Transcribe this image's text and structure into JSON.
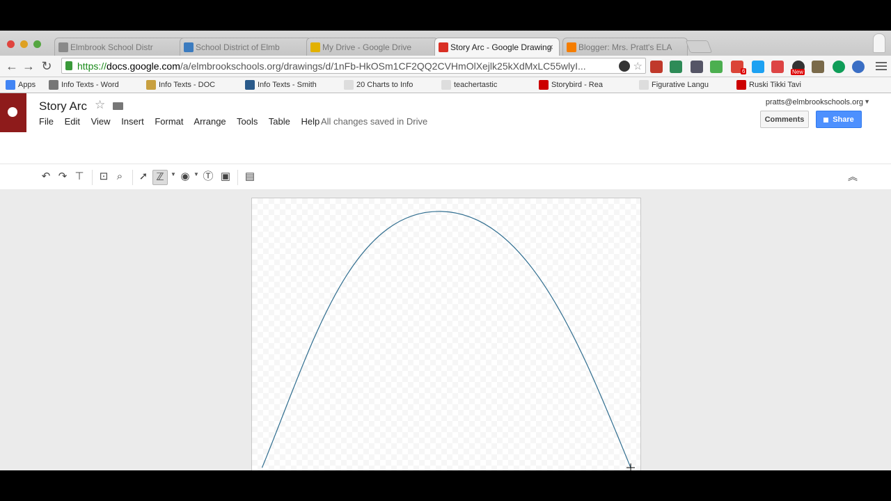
{
  "browser": {
    "tabs": [
      {
        "title": "Elmbrook School Distr",
        "active": false
      },
      {
        "title": "School District of Elmb",
        "active": false
      },
      {
        "title": "My Drive - Google Drive",
        "active": false
      },
      {
        "title": "Story Arc - Google Drawing",
        "active": true
      },
      {
        "title": "Blogger: Mrs. Pratt's ELA",
        "active": false
      }
    ],
    "close_glyph": "×",
    "url_scheme": "https://",
    "url_host": "docs.google.com",
    "url_path": "/a/elmbrookschools.org/drawings/d/1nFb-HkOSm1CF2QQ2CVHmOlXejlk25kXdMxLC55wlyI...",
    "bookmarks": [
      "Apps",
      "Info Texts - Word",
      "Info Texts - DOC",
      "Info Texts - Smith",
      "20 Charts to Info",
      "teachertastic",
      "Storybird - Rea",
      "Figurative Langu",
      "Ruski Tikki Tavi"
    ],
    "extension_badge_count": "6",
    "extension_badge_new": "New"
  },
  "docs": {
    "title": "Story Arc",
    "menus": [
      "File",
      "Edit",
      "View",
      "Insert",
      "Format",
      "Arrange",
      "Tools",
      "Table",
      "Help"
    ],
    "save_status": "All changes saved in Drive",
    "account": "pratts@elmbrookschools.org",
    "comments_label": "Comments",
    "share_label": "Share"
  },
  "icons": {
    "undo": "undo-icon",
    "redo": "redo-icon",
    "paint_format": "paint-format-icon",
    "zoom_fit": "zoom-fit-icon",
    "zoom": "zoom-icon",
    "select": "select-icon",
    "line": "line-tool-icon",
    "shape": "shape-icon",
    "textbox": "textbox-icon",
    "image": "image-icon",
    "comment": "comment-icon",
    "collapse": "collapse-icon"
  },
  "colors": {
    "curve": "#2f6d8f",
    "share": "#4d90fe",
    "logo": "#8e1b1b"
  },
  "drawing": {
    "shape": "curve",
    "points": [
      [
        0.026,
        0.926
      ],
      [
        0.482,
        0.045
      ],
      [
        0.975,
        0.926
      ]
    ]
  }
}
